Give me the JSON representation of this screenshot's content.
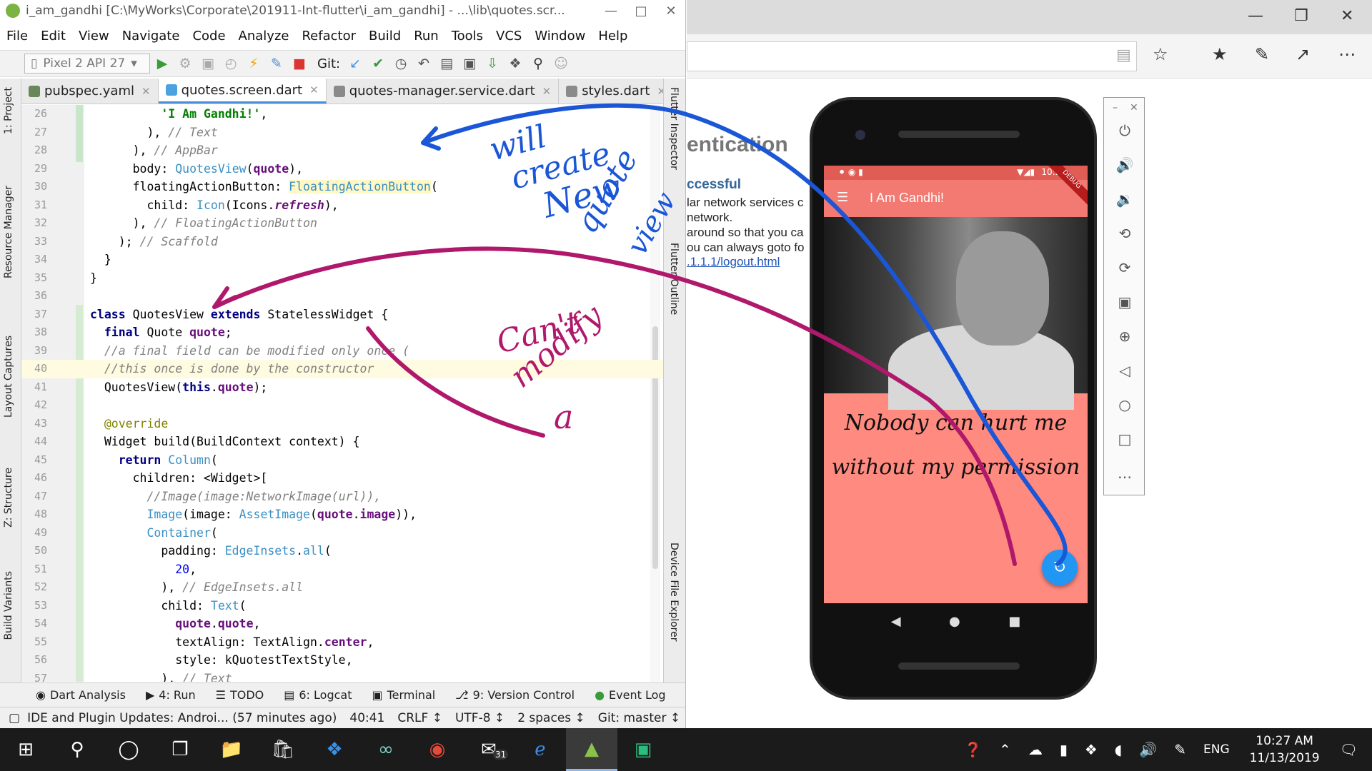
{
  "ide": {
    "title": "i_am_gandhi [C:\\MyWorks\\Corporate\\201911-Int-flutter\\i_am_gandhi] - ...\\lib\\quotes.scr...",
    "menu": [
      "File",
      "Edit",
      "View",
      "Navigate",
      "Code",
      "Analyze",
      "Refactor",
      "Build",
      "Run",
      "Tools",
      "VCS",
      "Window",
      "Help"
    ],
    "device": "Pixel 2 API 27",
    "git_label": "Git:",
    "tabs": [
      {
        "label": "pubspec.yaml",
        "icon_color": "#6a8759"
      },
      {
        "label": "quotes.screen.dart",
        "icon_color": "#4aa3df",
        "active": true
      },
      {
        "label": "quotes-manager.service.dart",
        "icon_color": "#8a8a8a"
      },
      {
        "label": "styles.dart",
        "icon_color": "#8a8a8a"
      }
    ],
    "left_tools": [
      "1: Project",
      "Resource Manager",
      "Layout Captures",
      "Z: Structure",
      "Build Variants"
    ],
    "right_tools": [
      "Flutter Inspector",
      "Flutter Outline",
      "Device File Explorer"
    ],
    "code_lines": [
      {
        "n": "26",
        "html": "          <span class='str'>'I Am Gandhi!'</span>,"
      },
      {
        "n": "27",
        "html": "        ), <span class='cm'>// Text</span>"
      },
      {
        "n": "28",
        "html": "      ), <span class='cm'>// AppBar</span>"
      },
      {
        "n": "29",
        "html": "      body: <span class='cls'>QuotesView</span>(<span class='fld'>quote</span>),"
      },
      {
        "n": "30",
        "html": "      floatingActionButton: <span class='hlcls'>FloatingActionButton</span>("
      },
      {
        "n": "31",
        "html": "        child: <span class='cls'>Icon</span>(Icons.<span class='fld' style='font-style:italic'>refresh</span>),"
      },
      {
        "n": "32",
        "html": "      ), <span class='cm'>// FloatingActionButton</span>"
      },
      {
        "n": "33",
        "html": "    ); <span class='cm'>// Scaffold</span>"
      },
      {
        "n": "34",
        "html": "  }"
      },
      {
        "n": "35",
        "html": "}"
      },
      {
        "n": "36",
        "html": ""
      },
      {
        "n": "37",
        "html": "<span class='kw'>class</span> QuotesView <span class='kw'>extends</span> StatelessWidget {"
      },
      {
        "n": "38",
        "html": "  <span class='kw'>final</span> Quote <span class='fld'>quote</span>;"
      },
      {
        "n": "39",
        "html": "  <span class='cm'>//a final field can be modified only once (</span>"
      },
      {
        "n": "40",
        "html": "  <span class='cm'>//this once is done by the constructor</span>",
        "hl": true
      },
      {
        "n": "41",
        "html": "  QuotesView(<span class='kw'>this</span>.<span class='fld'>quote</span>);"
      },
      {
        "n": "42",
        "html": ""
      },
      {
        "n": "43",
        "html": "  <span class='ann'>@override</span>"
      },
      {
        "n": "44",
        "html": "  Widget build(BuildContext context) {"
      },
      {
        "n": "45",
        "html": "    <span class='kw'>return</span> <span class='cls'>Column</span>("
      },
      {
        "n": "46",
        "html": "      children: &lt;Widget&gt;["
      },
      {
        "n": "47",
        "html": "        <span class='cm'>//Image(image:NetworkImage(url)),</span>"
      },
      {
        "n": "48",
        "html": "        <span class='cls'>Image</span>(image: <span class='cls'>AssetImage</span>(<span class='fld'>quote</span>.<span class='fld'>image</span>)),"
      },
      {
        "n": "49",
        "html": "        <span class='cls'>Container</span>("
      },
      {
        "n": "50",
        "html": "          padding: <span class='cls'>EdgeInsets</span>.<span class='cls'>all</span>("
      },
      {
        "n": "51",
        "html": "            <span class='num'>20</span>,"
      },
      {
        "n": "52",
        "html": "          ), <span class='cm'>// EdgeInsets.all</span>"
      },
      {
        "n": "53",
        "html": "          child: <span class='cls'>Text</span>("
      },
      {
        "n": "54",
        "html": "            <span class='fld'>quote</span>.<span class='fld'>quote</span>,"
      },
      {
        "n": "55",
        "html": "            textAlign: TextAlign.<span class='fld'>center</span>,"
      },
      {
        "n": "56",
        "html": "            style: kQuotestTextStyle,"
      },
      {
        "n": "57",
        "html": "          ), <span class='cm'>// Text</span>"
      }
    ],
    "tool_windows": [
      {
        "label": "Dart Analysis",
        "icon": "dart-analysis-icon"
      },
      {
        "label": "4: Run",
        "icon": "run-icon"
      },
      {
        "label": "TODO",
        "icon": "todo-icon"
      },
      {
        "label": "6: Logcat",
        "icon": "logcat-icon"
      },
      {
        "label": "Terminal",
        "icon": "terminal-icon"
      },
      {
        "label": "9: Version Control",
        "icon": "version-control-icon"
      },
      {
        "label": "Event Log",
        "icon": "event-log-icon"
      }
    ],
    "status": {
      "message": "IDE and Plugin Updates: Androi... (57 minutes ago)",
      "position": "40:41",
      "line_sep": "CRLF ↕",
      "encoding": "UTF-8 ↕",
      "indent": "2 spaces ↕",
      "branch": "Git: master ↕"
    }
  },
  "browser": {
    "heading": "entication",
    "subheading": "ccessful",
    "lines": [
      "lar network services c",
      "network.",
      "around so that you ca",
      "ou can always goto fo"
    ],
    "link": ".1.1.1/logout.html"
  },
  "emulator": {
    "time": "10:27",
    "app_title": "I Am Gandhi!",
    "debug_label": "DEBUG",
    "quote_line1": "Nobody can hurt me",
    "quote_line2": "without my permission",
    "fab_icon": "↻",
    "nav": [
      "◀",
      "●",
      "■"
    ],
    "panel_icons": [
      "power-icon",
      "volume-up-icon",
      "volume-down-icon",
      "rotate-left-icon",
      "rotate-right-icon",
      "camera-icon",
      "zoom-icon",
      "back-icon",
      "home-icon",
      "overview-icon",
      "more-icon"
    ],
    "panel_glyphs": [
      "⏻",
      "🔊",
      "🔉",
      "⟲",
      "⟳",
      "▣",
      "⊕",
      "◁",
      "○",
      "□",
      "…"
    ]
  },
  "taskbar": {
    "lang": "ENG",
    "time": "10:27 AM",
    "date": "11/13/2019",
    "mail_badge": "31"
  },
  "annotations": {
    "blue_text": [
      "will",
      "create",
      "New",
      "quote",
      "view"
    ],
    "magenta_text": [
      "Can't",
      "modify",
      "a"
    ]
  }
}
